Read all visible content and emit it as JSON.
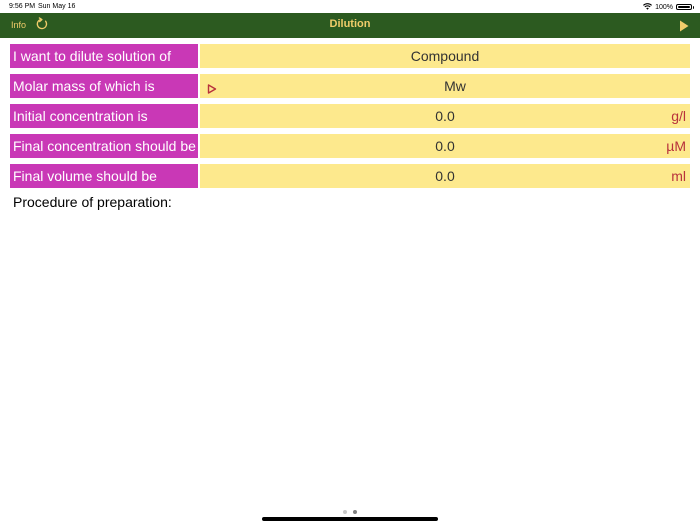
{
  "status_bar": {
    "time": "9:56 PM",
    "date": "Sun May 16",
    "battery": "100%"
  },
  "nav": {
    "info_label": "Info",
    "title": "Dilution",
    "refresh_icon": "refresh-icon",
    "play_icon": "play-icon"
  },
  "rows": {
    "compound": {
      "label": "I want to dilute solution of",
      "value": "Compound"
    },
    "molar_mass": {
      "label": "Molar mass of which is",
      "value": "Mw"
    },
    "initial_conc": {
      "label": "Initial concentration is",
      "value": "0.0",
      "unit": "g/l"
    },
    "final_conc": {
      "label": "Final concentration should be",
      "value": "0.0",
      "unit": "µM"
    },
    "final_volume": {
      "label": "Final volume should be",
      "value": "0.0",
      "unit": "ml"
    }
  },
  "procedure_label": "Procedure of preparation:",
  "page_indicator": {
    "pages": 2,
    "current": 2
  },
  "colors": {
    "nav_bg": "#2c5a20",
    "nav_text": "#f0cc6a",
    "label_bg": "#c938b6",
    "field_bg": "#fde98d",
    "unit_text": "#b8323c"
  }
}
